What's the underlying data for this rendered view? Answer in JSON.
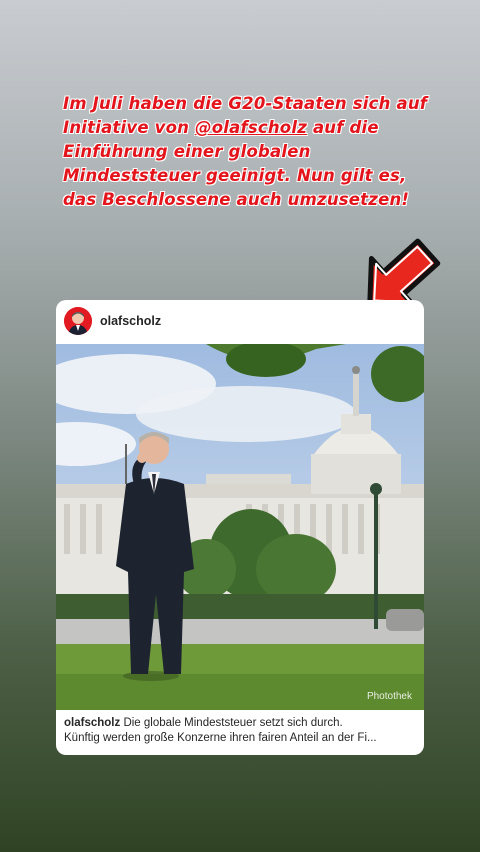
{
  "story": {
    "headline_parts": {
      "before": "Im Juli haben die G20-Staaten sich auf Initiative von ",
      "mention": "@olafscholz",
      "after": " auf die Einführung einer globalen Mindeststeuer geeinigt. Nun gilt es, das Beschlossene auch umzusetzen!"
    },
    "arrow_icon": "red-arrow-down-left",
    "text_color": "#e3141b"
  },
  "post": {
    "username": "olafscholz",
    "avatar_icon": "profile-avatar",
    "photo_credit": "Photothek",
    "caption_user": "olafscholz",
    "caption_line1": "Die globale Mindeststeuer setzt sich durch.",
    "caption_line2": "Künftig werden große Konzerne ihren fairen Anteil an der Fi..."
  }
}
